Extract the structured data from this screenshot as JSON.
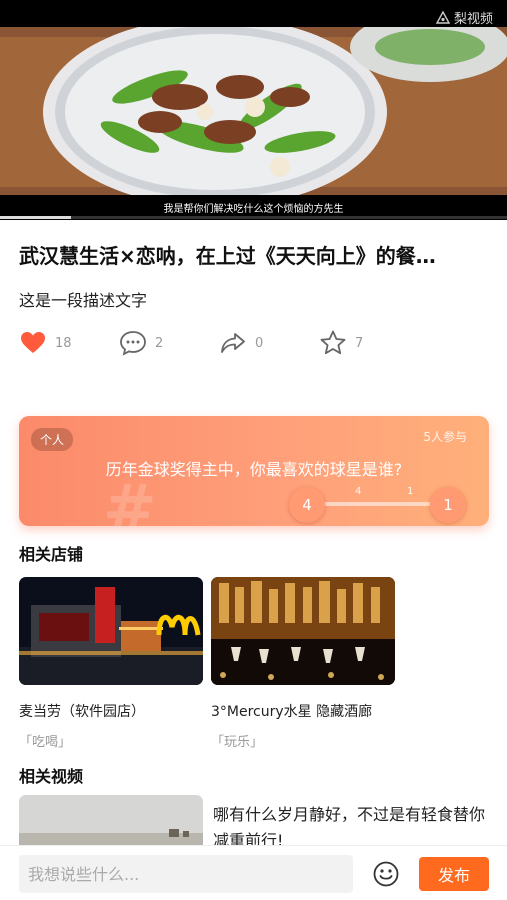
{
  "video": {
    "watermark": "梨视频",
    "caption": "我是帮你们解决吃什么这个烦恼的方先生",
    "progress_fraction": 0.14
  },
  "post": {
    "title": "武汉慧生活×恋呐，在上过《天天向上》的餐…",
    "description": "这是一段描述文字"
  },
  "actions": {
    "like_count": "18",
    "comment_count": "2",
    "share_count": "0",
    "favorite_count": "7",
    "like_color": "#ff5a3c"
  },
  "poll": {
    "tag": "个人",
    "participants": "5人参与",
    "question": "历年金球奖得主中，你最喜欢的球星是谁?",
    "left_value": "4",
    "left_small": "4",
    "right_small": "1",
    "right_value": "1",
    "hash_mark": "#"
  },
  "shops": {
    "title": "相关店铺",
    "items": [
      {
        "name": "麦当劳（软件园店）",
        "category": "「吃喝」"
      },
      {
        "name": "3°Mercury水星 隐藏酒廊",
        "category": "「玩乐」"
      }
    ]
  },
  "videos": {
    "title": "相关视频",
    "items": [
      {
        "title": "哪有什么岁月静好，不过是有轻食替你减重前行!"
      }
    ]
  },
  "bottom_bar": {
    "comment_placeholder": "我想说些什么...",
    "publish_label": "发布"
  }
}
